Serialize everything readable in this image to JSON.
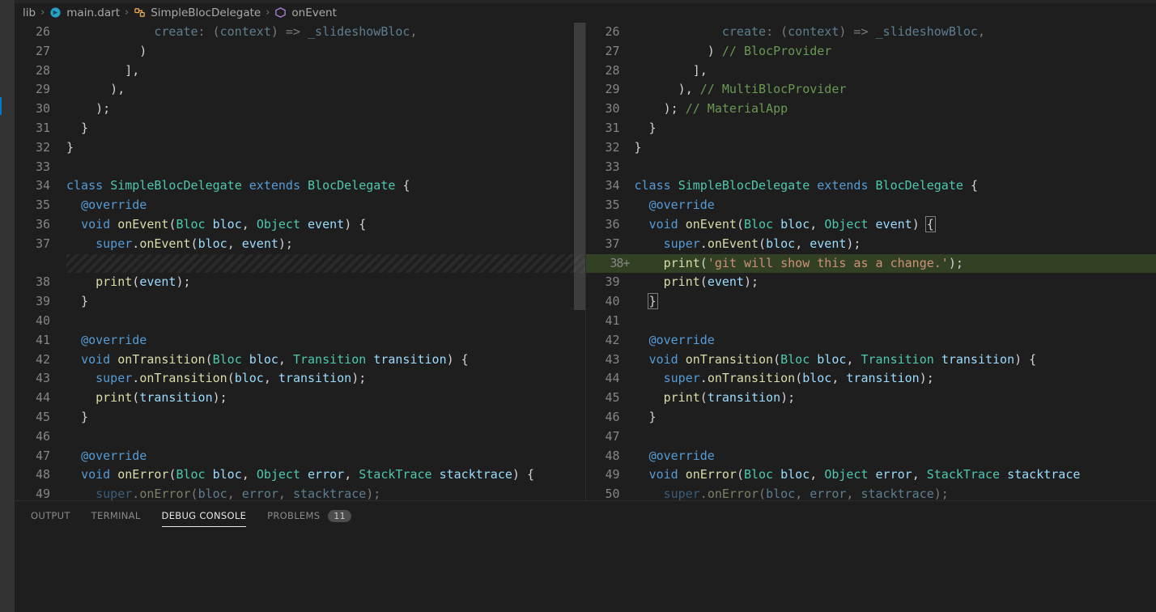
{
  "breadcrumb": {
    "folder": "lib",
    "file": "main.dart",
    "class": "SimpleBlocDelegate",
    "method": "onEvent"
  },
  "panel": {
    "tabs": {
      "output": "OUTPUT",
      "terminal": "TERMINAL",
      "debug": "DEBUG CONSOLE",
      "problems": "PROBLEMS",
      "problems_count": "11"
    }
  },
  "left_lines": [
    {
      "n": "26",
      "dim": true,
      "segs": [
        {
          "t": "            ",
          "c": "k-white"
        },
        {
          "t": "create",
          "c": "k-var"
        },
        {
          "t": ": (",
          "c": "k-white"
        },
        {
          "t": "context",
          "c": "k-var"
        },
        {
          "t": ") => ",
          "c": "k-white"
        },
        {
          "t": "_slideshowBloc",
          "c": "k-var"
        },
        {
          "t": ",",
          "c": "k-white"
        }
      ]
    },
    {
      "n": "27",
      "segs": [
        {
          "t": "          )",
          "c": "k-white"
        }
      ]
    },
    {
      "n": "28",
      "segs": [
        {
          "t": "        ],",
          "c": "k-white"
        }
      ]
    },
    {
      "n": "29",
      "segs": [
        {
          "t": "      ),",
          "c": "k-white"
        }
      ]
    },
    {
      "n": "30",
      "segs": [
        {
          "t": "    );",
          "c": "k-white"
        }
      ]
    },
    {
      "n": "31",
      "segs": [
        {
          "t": "  }",
          "c": "k-white"
        }
      ]
    },
    {
      "n": "32",
      "segs": [
        {
          "t": "}",
          "c": "k-white"
        }
      ]
    },
    {
      "n": "33",
      "segs": [
        {
          "t": "",
          "c": "k-white"
        }
      ]
    },
    {
      "n": "34",
      "segs": [
        {
          "t": "class ",
          "c": "k-blue"
        },
        {
          "t": "SimpleBlocDelegate ",
          "c": "k-teal"
        },
        {
          "t": "extends ",
          "c": "k-blue"
        },
        {
          "t": "BlocDelegate ",
          "c": "k-teal"
        },
        {
          "t": "{",
          "c": "k-white"
        }
      ]
    },
    {
      "n": "35",
      "segs": [
        {
          "t": "  ",
          "c": "k-white"
        },
        {
          "t": "@override",
          "c": "k-ann"
        }
      ]
    },
    {
      "n": "36",
      "segs": [
        {
          "t": "  ",
          "c": "k-white"
        },
        {
          "t": "void ",
          "c": "k-blue"
        },
        {
          "t": "onEvent",
          "c": "k-fn"
        },
        {
          "t": "(",
          "c": "k-white"
        },
        {
          "t": "Bloc ",
          "c": "k-teal"
        },
        {
          "t": "bloc",
          "c": "k-var"
        },
        {
          "t": ", ",
          "c": "k-white"
        },
        {
          "t": "Object ",
          "c": "k-teal"
        },
        {
          "t": "event",
          "c": "k-var"
        },
        {
          "t": ") {",
          "c": "k-white"
        }
      ]
    },
    {
      "n": "37",
      "segs": [
        {
          "t": "    ",
          "c": "k-white"
        },
        {
          "t": "super",
          "c": "k-blue"
        },
        {
          "t": ".",
          "c": "k-white"
        },
        {
          "t": "onEvent",
          "c": "k-fn"
        },
        {
          "t": "(",
          "c": "k-white"
        },
        {
          "t": "bloc",
          "c": "k-var"
        },
        {
          "t": ", ",
          "c": "k-white"
        },
        {
          "t": "event",
          "c": "k-var"
        },
        {
          "t": ");",
          "c": "k-white"
        }
      ]
    },
    {
      "empty": true
    },
    {
      "n": "38",
      "segs": [
        {
          "t": "    ",
          "c": "k-white"
        },
        {
          "t": "print",
          "c": "k-fn"
        },
        {
          "t": "(",
          "c": "k-white"
        },
        {
          "t": "event",
          "c": "k-var"
        },
        {
          "t": ");",
          "c": "k-white"
        }
      ]
    },
    {
      "n": "39",
      "segs": [
        {
          "t": "  }",
          "c": "k-white"
        }
      ]
    },
    {
      "n": "40",
      "segs": [
        {
          "t": "",
          "c": "k-white"
        }
      ]
    },
    {
      "n": "41",
      "segs": [
        {
          "t": "  ",
          "c": "k-white"
        },
        {
          "t": "@override",
          "c": "k-ann"
        }
      ]
    },
    {
      "n": "42",
      "segs": [
        {
          "t": "  ",
          "c": "k-white"
        },
        {
          "t": "void ",
          "c": "k-blue"
        },
        {
          "t": "onTransition",
          "c": "k-fn"
        },
        {
          "t": "(",
          "c": "k-white"
        },
        {
          "t": "Bloc ",
          "c": "k-teal"
        },
        {
          "t": "bloc",
          "c": "k-var"
        },
        {
          "t": ", ",
          "c": "k-white"
        },
        {
          "t": "Transition ",
          "c": "k-teal"
        },
        {
          "t": "transition",
          "c": "k-var"
        },
        {
          "t": ") {",
          "c": "k-white"
        }
      ]
    },
    {
      "n": "43",
      "segs": [
        {
          "t": "    ",
          "c": "k-white"
        },
        {
          "t": "super",
          "c": "k-blue"
        },
        {
          "t": ".",
          "c": "k-white"
        },
        {
          "t": "onTransition",
          "c": "k-fn"
        },
        {
          "t": "(",
          "c": "k-white"
        },
        {
          "t": "bloc",
          "c": "k-var"
        },
        {
          "t": ", ",
          "c": "k-white"
        },
        {
          "t": "transition",
          "c": "k-var"
        },
        {
          "t": ");",
          "c": "k-white"
        }
      ]
    },
    {
      "n": "44",
      "segs": [
        {
          "t": "    ",
          "c": "k-white"
        },
        {
          "t": "print",
          "c": "k-fn"
        },
        {
          "t": "(",
          "c": "k-white"
        },
        {
          "t": "transition",
          "c": "k-var"
        },
        {
          "t": ");",
          "c": "k-white"
        }
      ]
    },
    {
      "n": "45",
      "segs": [
        {
          "t": "  }",
          "c": "k-white"
        }
      ]
    },
    {
      "n": "46",
      "segs": [
        {
          "t": "",
          "c": "k-white"
        }
      ]
    },
    {
      "n": "47",
      "segs": [
        {
          "t": "  ",
          "c": "k-white"
        },
        {
          "t": "@override",
          "c": "k-ann"
        }
      ]
    },
    {
      "n": "48",
      "segs": [
        {
          "t": "  ",
          "c": "k-white"
        },
        {
          "t": "void ",
          "c": "k-blue"
        },
        {
          "t": "onError",
          "c": "k-fn"
        },
        {
          "t": "(",
          "c": "k-white"
        },
        {
          "t": "Bloc ",
          "c": "k-teal"
        },
        {
          "t": "bloc",
          "c": "k-var"
        },
        {
          "t": ", ",
          "c": "k-white"
        },
        {
          "t": "Object ",
          "c": "k-teal"
        },
        {
          "t": "error",
          "c": "k-var"
        },
        {
          "t": ", ",
          "c": "k-white"
        },
        {
          "t": "StackTrace ",
          "c": "k-teal"
        },
        {
          "t": "stacktrace",
          "c": "k-var"
        },
        {
          "t": ") {",
          "c": "k-white"
        }
      ]
    },
    {
      "n": "49",
      "dim": true,
      "segs": [
        {
          "t": "    ",
          "c": "k-white"
        },
        {
          "t": "super",
          "c": "k-blue"
        },
        {
          "t": ".",
          "c": "k-white"
        },
        {
          "t": "onError",
          "c": "k-fn"
        },
        {
          "t": "(",
          "c": "k-white"
        },
        {
          "t": "bloc",
          "c": "k-var"
        },
        {
          "t": ", ",
          "c": "k-white"
        },
        {
          "t": "error",
          "c": "k-var"
        },
        {
          "t": ", ",
          "c": "k-white"
        },
        {
          "t": "stacktrace",
          "c": "k-var"
        },
        {
          "t": ");",
          "c": "k-white"
        }
      ]
    }
  ],
  "right_lines": [
    {
      "n": "26",
      "dim": true,
      "segs": [
        {
          "t": "            ",
          "c": "k-white"
        },
        {
          "t": "create",
          "c": "k-var"
        },
        {
          "t": ": (",
          "c": "k-white"
        },
        {
          "t": "context",
          "c": "k-var"
        },
        {
          "t": ") => ",
          "c": "k-white"
        },
        {
          "t": "_slideshowBloc",
          "c": "k-var"
        },
        {
          "t": ",",
          "c": "k-white"
        }
      ]
    },
    {
      "n": "27",
      "segs": [
        {
          "t": "          ) ",
          "c": "k-white"
        },
        {
          "t": "// BlocProvider",
          "c": "k-comment"
        }
      ]
    },
    {
      "n": "28",
      "segs": [
        {
          "t": "        ],",
          "c": "k-white"
        }
      ]
    },
    {
      "n": "29",
      "segs": [
        {
          "t": "      ), ",
          "c": "k-white"
        },
        {
          "t": "// MultiBlocProvider",
          "c": "k-comment"
        }
      ]
    },
    {
      "n": "30",
      "segs": [
        {
          "t": "    ); ",
          "c": "k-white"
        },
        {
          "t": "// MaterialApp",
          "c": "k-comment"
        }
      ]
    },
    {
      "n": "31",
      "segs": [
        {
          "t": "  }",
          "c": "k-white"
        }
      ]
    },
    {
      "n": "32",
      "segs": [
        {
          "t": "}",
          "c": "k-white"
        }
      ]
    },
    {
      "n": "33",
      "segs": [
        {
          "t": "",
          "c": "k-white"
        }
      ]
    },
    {
      "n": "34",
      "segs": [
        {
          "t": "class ",
          "c": "k-blue"
        },
        {
          "t": "SimpleBlocDelegate ",
          "c": "k-teal"
        },
        {
          "t": "extends ",
          "c": "k-blue"
        },
        {
          "t": "BlocDelegate ",
          "c": "k-teal"
        },
        {
          "t": "{",
          "c": "k-white"
        }
      ]
    },
    {
      "n": "35",
      "segs": [
        {
          "t": "  ",
          "c": "k-white"
        },
        {
          "t": "@override",
          "c": "k-ann"
        }
      ]
    },
    {
      "n": "36",
      "segs": [
        {
          "t": "  ",
          "c": "k-white"
        },
        {
          "t": "void ",
          "c": "k-blue"
        },
        {
          "t": "onEvent",
          "c": "k-fn"
        },
        {
          "t": "(",
          "c": "k-white"
        },
        {
          "t": "Bloc ",
          "c": "k-teal"
        },
        {
          "t": "bloc",
          "c": "k-var"
        },
        {
          "t": ", ",
          "c": "k-white"
        },
        {
          "t": "Object ",
          "c": "k-teal"
        },
        {
          "t": "event",
          "c": "k-var"
        },
        {
          "t": ") ",
          "c": "k-white"
        },
        {
          "t": "{",
          "c": "k-white",
          "box": true
        }
      ]
    },
    {
      "n": "37",
      "segs": [
        {
          "t": "    ",
          "c": "k-white"
        },
        {
          "t": "super",
          "c": "k-blue"
        },
        {
          "t": ".",
          "c": "k-white"
        },
        {
          "t": "onEvent",
          "c": "k-fn"
        },
        {
          "t": "(",
          "c": "k-white"
        },
        {
          "t": "bloc",
          "c": "k-var"
        },
        {
          "t": ", ",
          "c": "k-white"
        },
        {
          "t": "event",
          "c": "k-var"
        },
        {
          "t": ");",
          "c": "k-white"
        }
      ]
    },
    {
      "n": "38+",
      "hl": true,
      "segs": [
        {
          "t": "    ",
          "c": "k-white"
        },
        {
          "t": "print",
          "c": "k-fn"
        },
        {
          "t": "(",
          "c": "k-white"
        },
        {
          "t": "'git will show this as a change.'",
          "c": "k-str"
        },
        {
          "t": ");",
          "c": "k-white"
        }
      ]
    },
    {
      "n": "39",
      "segs": [
        {
          "t": "    ",
          "c": "k-white"
        },
        {
          "t": "print",
          "c": "k-fn"
        },
        {
          "t": "(",
          "c": "k-white"
        },
        {
          "t": "event",
          "c": "k-var"
        },
        {
          "t": ");",
          "c": "k-white"
        }
      ]
    },
    {
      "n": "40",
      "segs": [
        {
          "t": "  ",
          "c": "k-white"
        },
        {
          "t": "}",
          "c": "k-white",
          "box": true
        }
      ]
    },
    {
      "n": "41",
      "segs": [
        {
          "t": "",
          "c": "k-white"
        }
      ]
    },
    {
      "n": "42",
      "segs": [
        {
          "t": "  ",
          "c": "k-white"
        },
        {
          "t": "@override",
          "c": "k-ann"
        }
      ]
    },
    {
      "n": "43",
      "segs": [
        {
          "t": "  ",
          "c": "k-white"
        },
        {
          "t": "void ",
          "c": "k-blue"
        },
        {
          "t": "onTransition",
          "c": "k-fn"
        },
        {
          "t": "(",
          "c": "k-white"
        },
        {
          "t": "Bloc ",
          "c": "k-teal"
        },
        {
          "t": "bloc",
          "c": "k-var"
        },
        {
          "t": ", ",
          "c": "k-white"
        },
        {
          "t": "Transition ",
          "c": "k-teal"
        },
        {
          "t": "transition",
          "c": "k-var"
        },
        {
          "t": ") {",
          "c": "k-white"
        }
      ]
    },
    {
      "n": "44",
      "segs": [
        {
          "t": "    ",
          "c": "k-white"
        },
        {
          "t": "super",
          "c": "k-blue"
        },
        {
          "t": ".",
          "c": "k-white"
        },
        {
          "t": "onTransition",
          "c": "k-fn"
        },
        {
          "t": "(",
          "c": "k-white"
        },
        {
          "t": "bloc",
          "c": "k-var"
        },
        {
          "t": ", ",
          "c": "k-white"
        },
        {
          "t": "transition",
          "c": "k-var"
        },
        {
          "t": ");",
          "c": "k-white"
        }
      ]
    },
    {
      "n": "45",
      "segs": [
        {
          "t": "    ",
          "c": "k-white"
        },
        {
          "t": "print",
          "c": "k-fn"
        },
        {
          "t": "(",
          "c": "k-white"
        },
        {
          "t": "transition",
          "c": "k-var"
        },
        {
          "t": ");",
          "c": "k-white"
        }
      ]
    },
    {
      "n": "46",
      "segs": [
        {
          "t": "  }",
          "c": "k-white"
        }
      ]
    },
    {
      "n": "47",
      "segs": [
        {
          "t": "",
          "c": "k-white"
        }
      ]
    },
    {
      "n": "48",
      "segs": [
        {
          "t": "  ",
          "c": "k-white"
        },
        {
          "t": "@override",
          "c": "k-ann"
        }
      ]
    },
    {
      "n": "49",
      "segs": [
        {
          "t": "  ",
          "c": "k-white"
        },
        {
          "t": "void ",
          "c": "k-blue"
        },
        {
          "t": "onError",
          "c": "k-fn"
        },
        {
          "t": "(",
          "c": "k-white"
        },
        {
          "t": "Bloc ",
          "c": "k-teal"
        },
        {
          "t": "bloc",
          "c": "k-var"
        },
        {
          "t": ", ",
          "c": "k-white"
        },
        {
          "t": "Object ",
          "c": "k-teal"
        },
        {
          "t": "error",
          "c": "k-var"
        },
        {
          "t": ", ",
          "c": "k-white"
        },
        {
          "t": "StackTrace ",
          "c": "k-teal"
        },
        {
          "t": "stacktrace",
          "c": "k-var"
        }
      ]
    },
    {
      "n": "50",
      "dim": true,
      "segs": [
        {
          "t": "    ",
          "c": "k-white"
        },
        {
          "t": "super",
          "c": "k-blue"
        },
        {
          "t": ".",
          "c": "k-white"
        },
        {
          "t": "onError",
          "c": "k-fn"
        },
        {
          "t": "(",
          "c": "k-white"
        },
        {
          "t": "bloc",
          "c": "k-var"
        },
        {
          "t": ", ",
          "c": "k-white"
        },
        {
          "t": "error",
          "c": "k-var"
        },
        {
          "t": ", ",
          "c": "k-white"
        },
        {
          "t": "stacktrace",
          "c": "k-var"
        },
        {
          "t": ");",
          "c": "k-white"
        }
      ]
    }
  ]
}
